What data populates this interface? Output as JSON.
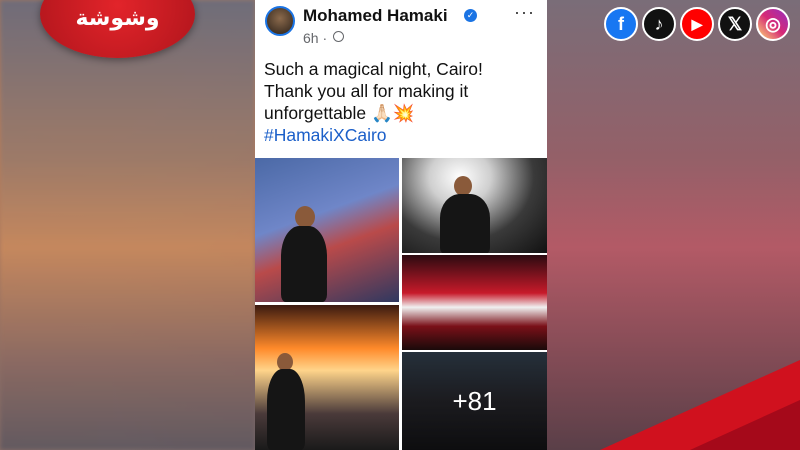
{
  "brand": {
    "logo_text": "وشوشة"
  },
  "social_icons": [
    {
      "name": "facebook-icon",
      "glyph": "f",
      "color": "#1877f2"
    },
    {
      "name": "tiktok-icon",
      "glyph": "♪",
      "color": "#111111"
    },
    {
      "name": "youtube-icon",
      "glyph": "▶",
      "color": "#ff0000"
    },
    {
      "name": "x-icon",
      "glyph": "𝕏",
      "color": "#111111"
    },
    {
      "name": "instagram-icon",
      "glyph": "◎",
      "color": "#d6249f"
    }
  ],
  "post": {
    "author": "Mohamed Hamaki",
    "time": "6h ·",
    "more": "···",
    "text_line1": "Such a magical night, Cairo!",
    "text_line2": "Thank you all for making it",
    "text_line3": "unforgettable 🙏🏻💥",
    "hashtag": "#HamakiXCairo",
    "more_photos": "+81"
  }
}
